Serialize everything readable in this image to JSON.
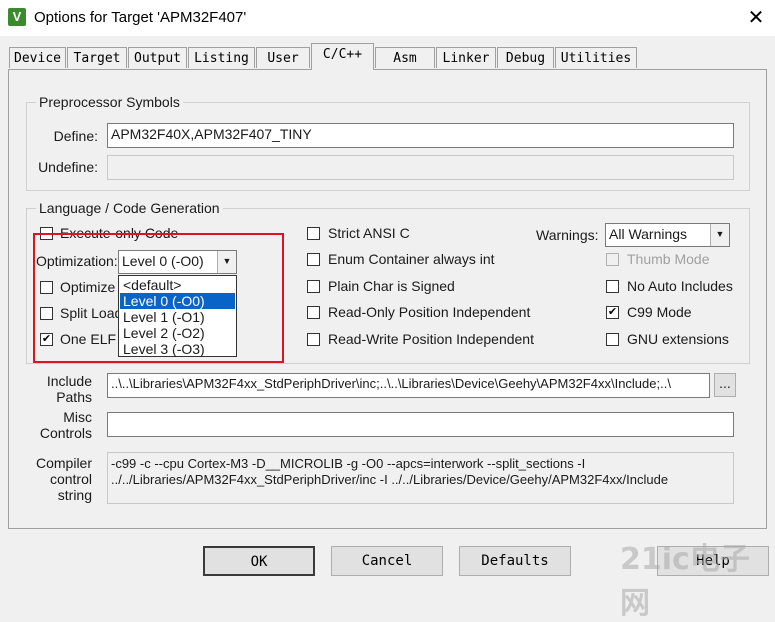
{
  "window": {
    "title": "Options for Target 'APM32F407'",
    "icon_glyph": "V",
    "close_glyph": "✕"
  },
  "tabs": [
    {
      "label": "Device"
    },
    {
      "label": "Target"
    },
    {
      "label": "Output"
    },
    {
      "label": "Listing"
    },
    {
      "label": "User"
    },
    {
      "label": "C/C++",
      "active": true
    },
    {
      "label": "Asm"
    },
    {
      "label": "Linker"
    },
    {
      "label": "Debug"
    },
    {
      "label": "Utilities"
    }
  ],
  "preprocessor": {
    "group_label": "Preprocessor Symbols",
    "define_label": "Define:",
    "define_value": "APM32F40X,APM32F407_TINY",
    "undefine_label": "Undefine:",
    "undefine_value": ""
  },
  "codegen": {
    "group_label": "Language / Code Generation",
    "execute_only": {
      "label": "Execute-only Code",
      "checked": false
    },
    "optimization": {
      "label": "Optimization:",
      "selected": "Level 0 (-O0)",
      "options": [
        "<default>",
        "Level 0 (-O0)",
        "Level 1 (-O1)",
        "Level 2 (-O2)",
        "Level 3 (-O3)"
      ],
      "highlighted_index": 1
    },
    "optimize_for_time": {
      "label": "Optimize f",
      "checked": false
    },
    "split_load": {
      "label": "Split Load",
      "checked": false
    },
    "one_elf": {
      "label": "One ELF",
      "checked": true,
      "check_glyph": "✔"
    },
    "strict_ansi": {
      "label": "Strict ANSI C",
      "checked": false
    },
    "enum_container": {
      "label": "Enum Container always int",
      "checked": false
    },
    "plain_char": {
      "label": "Plain Char is Signed",
      "checked": false
    },
    "ropi": {
      "label": "Read-Only Position Independent",
      "checked": false
    },
    "rwpi": {
      "label": "Read-Write Position Independent",
      "checked": false
    },
    "warnings": {
      "label": "Warnings:",
      "selected": "All Warnings"
    },
    "thumb_mode": {
      "label": "Thumb Mode",
      "checked": false,
      "disabled": true
    },
    "no_auto_includes": {
      "label": "No Auto Includes",
      "checked": false
    },
    "c99_mode": {
      "label": "C99 Mode",
      "checked": true,
      "check_glyph": "✔"
    },
    "gnu_extensions": {
      "label": "GNU extensions",
      "checked": false
    }
  },
  "include_paths": {
    "label_line1": "Include",
    "label_line2": "Paths",
    "value": "..\\..\\Libraries\\APM32F4xx_StdPeriphDriver\\inc;..\\..\\Libraries\\Device\\Geehy\\APM32F4xx\\Include;..\\",
    "browse_label": "..."
  },
  "misc_controls": {
    "label_line1": "Misc",
    "label_line2": "Controls",
    "value": ""
  },
  "compiler_control": {
    "label_line1": "Compiler",
    "label_line2": "control",
    "label_line3": "string",
    "line1": "-c99 -c --cpu Cortex-M3 -D__MICROLIB -g -O0 --apcs=interwork --split_sections -I",
    "line2": "../../Libraries/APM32F4xx_StdPeriphDriver/inc -I ../../Libraries/Device/Geehy/APM32F4xx/Include"
  },
  "buttons": {
    "ok": "OK",
    "cancel": "Cancel",
    "defaults": "Defaults",
    "help": "Help"
  },
  "watermark": "21ic电子网",
  "arrow_glyph": "▼"
}
